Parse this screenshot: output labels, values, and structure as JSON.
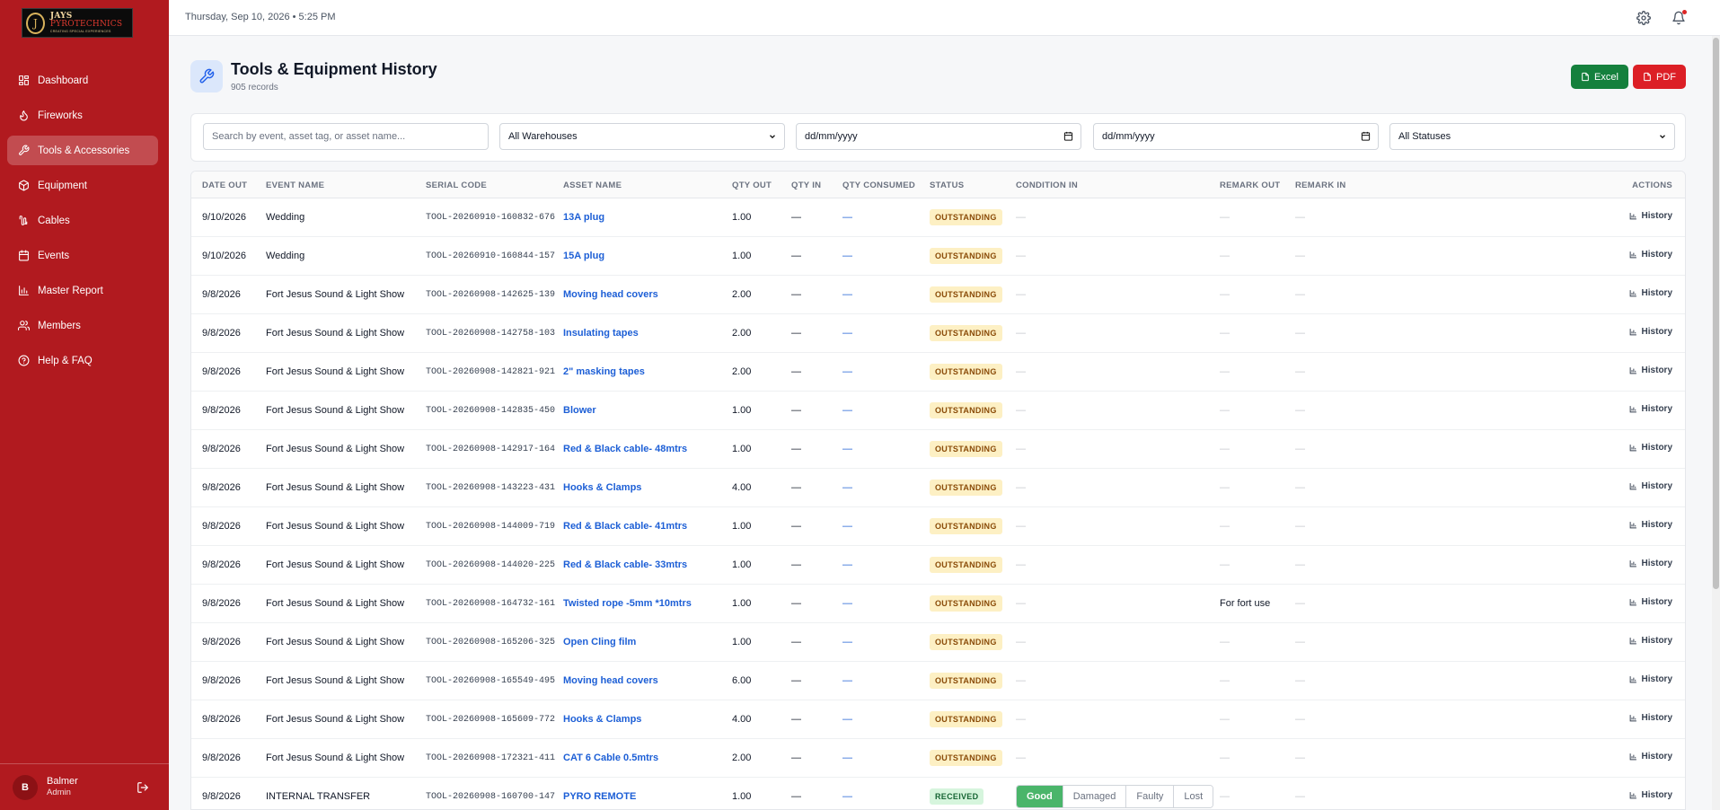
{
  "app": {
    "logo_name_1": "JAYS",
    "logo_name_2": "PYROTECHNICS",
    "logo_tagline": "CREATING SPECIAL EXPERIENCES"
  },
  "topbar": {
    "datetime": "Thursday, Sep 10, 2026  •  5:25 PM"
  },
  "sidebar": {
    "items": [
      {
        "label": "Dashboard",
        "icon": "grid-icon"
      },
      {
        "label": "Fireworks",
        "icon": "flame-icon"
      },
      {
        "label": "Tools & Accessories",
        "icon": "wrench-icon",
        "active": true
      },
      {
        "label": "Equipment",
        "icon": "box-icon"
      },
      {
        "label": "Cables",
        "icon": "cable-icon"
      },
      {
        "label": "Events",
        "icon": "calendar-icon"
      },
      {
        "label": "Master Report",
        "icon": "bar-chart-icon"
      },
      {
        "label": "Members",
        "icon": "users-icon"
      },
      {
        "label": "Help & FAQ",
        "icon": "help-circle-icon"
      }
    ],
    "user": {
      "initial": "B",
      "name": "Balmer",
      "role": "Admin"
    }
  },
  "header": {
    "title": "Tools & Equipment History",
    "subtitle": "905 records",
    "excel_label": "Excel",
    "pdf_label": "PDF"
  },
  "filters": {
    "search_placeholder": "Search by event, asset tag, or asset name...",
    "warehouse": "All Warehouses",
    "date_from": "dd/mm/yyyy",
    "date_to": "dd/mm/yyyy",
    "status": "All Statuses"
  },
  "table": {
    "columns": [
      "Date Out",
      "Event Name",
      "Serial Code",
      "Asset Name",
      "Qty Out",
      "Qty In",
      "Qty Consumed",
      "Status",
      "Condition In",
      "Remark Out",
      "Remark In",
      "Actions"
    ],
    "action_label": "History",
    "rows": [
      {
        "date": "9/10/2026",
        "event": "Wedding",
        "serial": "TOOL-20260910-160832-676",
        "asset": "13A plug",
        "qty_out": "1.00",
        "qty_in": "—",
        "consumed": "—",
        "status": "OUTSTANDING",
        "condition": "—",
        "remark_out": "—",
        "remark_in": "—"
      },
      {
        "date": "9/10/2026",
        "event": "Wedding",
        "serial": "TOOL-20260910-160844-157",
        "asset": "15A plug",
        "qty_out": "1.00",
        "qty_in": "—",
        "consumed": "—",
        "status": "OUTSTANDING",
        "condition": "—",
        "remark_out": "—",
        "remark_in": "—"
      },
      {
        "date": "9/8/2026",
        "event": "Fort Jesus Sound & Light Show",
        "serial": "TOOL-20260908-142625-139",
        "asset": "Moving head covers",
        "qty_out": "2.00",
        "qty_in": "—",
        "consumed": "—",
        "status": "OUTSTANDING",
        "condition": "—",
        "remark_out": "—",
        "remark_in": "—"
      },
      {
        "date": "9/8/2026",
        "event": "Fort Jesus Sound & Light Show",
        "serial": "TOOL-20260908-142758-103",
        "asset": "Insulating tapes",
        "qty_out": "2.00",
        "qty_in": "—",
        "consumed": "—",
        "status": "OUTSTANDING",
        "condition": "—",
        "remark_out": "—",
        "remark_in": "—"
      },
      {
        "date": "9/8/2026",
        "event": "Fort Jesus Sound & Light Show",
        "serial": "TOOL-20260908-142821-921",
        "asset": "2\" masking tapes",
        "qty_out": "2.00",
        "qty_in": "—",
        "consumed": "—",
        "status": "OUTSTANDING",
        "condition": "—",
        "remark_out": "—",
        "remark_in": "—"
      },
      {
        "date": "9/8/2026",
        "event": "Fort Jesus Sound & Light Show",
        "serial": "TOOL-20260908-142835-450",
        "asset": "Blower",
        "qty_out": "1.00",
        "qty_in": "—",
        "consumed": "—",
        "status": "OUTSTANDING",
        "condition": "—",
        "remark_out": "—",
        "remark_in": "—"
      },
      {
        "date": "9/8/2026",
        "event": "Fort Jesus Sound & Light Show",
        "serial": "TOOL-20260908-142917-164",
        "asset": "Red & Black cable- 48mtrs",
        "qty_out": "1.00",
        "qty_in": "—",
        "consumed": "—",
        "status": "OUTSTANDING",
        "condition": "—",
        "remark_out": "—",
        "remark_in": "—"
      },
      {
        "date": "9/8/2026",
        "event": "Fort Jesus Sound & Light Show",
        "serial": "TOOL-20260908-143223-431",
        "asset": "Hooks & Clamps",
        "qty_out": "4.00",
        "qty_in": "—",
        "consumed": "—",
        "status": "OUTSTANDING",
        "condition": "—",
        "remark_out": "—",
        "remark_in": "—"
      },
      {
        "date": "9/8/2026",
        "event": "Fort Jesus Sound & Light Show",
        "serial": "TOOL-20260908-144009-719",
        "asset": "Red & Black cable- 41mtrs",
        "qty_out": "1.00",
        "qty_in": "—",
        "consumed": "—",
        "status": "OUTSTANDING",
        "condition": "—",
        "remark_out": "—",
        "remark_in": "—"
      },
      {
        "date": "9/8/2026",
        "event": "Fort Jesus Sound & Light Show",
        "serial": "TOOL-20260908-144020-225",
        "asset": "Red & Black cable- 33mtrs",
        "qty_out": "1.00",
        "qty_in": "—",
        "consumed": "—",
        "status": "OUTSTANDING",
        "condition": "—",
        "remark_out": "—",
        "remark_in": "—"
      },
      {
        "date": "9/8/2026",
        "event": "Fort Jesus Sound & Light Show",
        "serial": "TOOL-20260908-164732-161",
        "asset": "Twisted rope -5mm *10mtrs",
        "qty_out": "1.00",
        "qty_in": "—",
        "consumed": "—",
        "status": "OUTSTANDING",
        "condition": "—",
        "remark_out": "For fort use",
        "remark_in": "—"
      },
      {
        "date": "9/8/2026",
        "event": "Fort Jesus Sound & Light Show",
        "serial": "TOOL-20260908-165206-325",
        "asset": "Open Cling film",
        "qty_out": "1.00",
        "qty_in": "—",
        "consumed": "—",
        "status": "OUTSTANDING",
        "condition": "—",
        "remark_out": "—",
        "remark_in": "—"
      },
      {
        "date": "9/8/2026",
        "event": "Fort Jesus Sound & Light Show",
        "serial": "TOOL-20260908-165549-495",
        "asset": "Moving head covers",
        "qty_out": "6.00",
        "qty_in": "—",
        "consumed": "—",
        "status": "OUTSTANDING",
        "condition": "—",
        "remark_out": "—",
        "remark_in": "—"
      },
      {
        "date": "9/8/2026",
        "event": "Fort Jesus Sound & Light Show",
        "serial": "TOOL-20260908-165609-772",
        "asset": "Hooks & Clamps",
        "qty_out": "4.00",
        "qty_in": "—",
        "consumed": "—",
        "status": "OUTSTANDING",
        "condition": "—",
        "remark_out": "—",
        "remark_in": "—"
      },
      {
        "date": "9/8/2026",
        "event": "Fort Jesus Sound & Light Show",
        "serial": "TOOL-20260908-172321-411",
        "asset": "CAT 6 Cable 0.5mtrs",
        "qty_out": "2.00",
        "qty_in": "—",
        "consumed": "—",
        "status": "OUTSTANDING",
        "condition": "—",
        "remark_out": "—",
        "remark_in": "—"
      },
      {
        "date": "9/8/2026",
        "event": "INTERNAL TRANSFER",
        "serial": "TOOL-20260908-160700-147",
        "asset": "PYRO REMOTE",
        "qty_out": "1.00",
        "qty_in": "—",
        "consumed": "—",
        "status": "RECEIVED",
        "condition_options": [
          "Good",
          "Damaged",
          "Faulty",
          "Lost"
        ],
        "condition_selected": "Good",
        "remark_out": "—",
        "remark_in": "—"
      }
    ]
  },
  "colors": {
    "brand_red": "#b11a1f",
    "link_blue": "#1d5fd6",
    "excel_green": "#15803d",
    "pdf_red": "#dc1f26"
  }
}
